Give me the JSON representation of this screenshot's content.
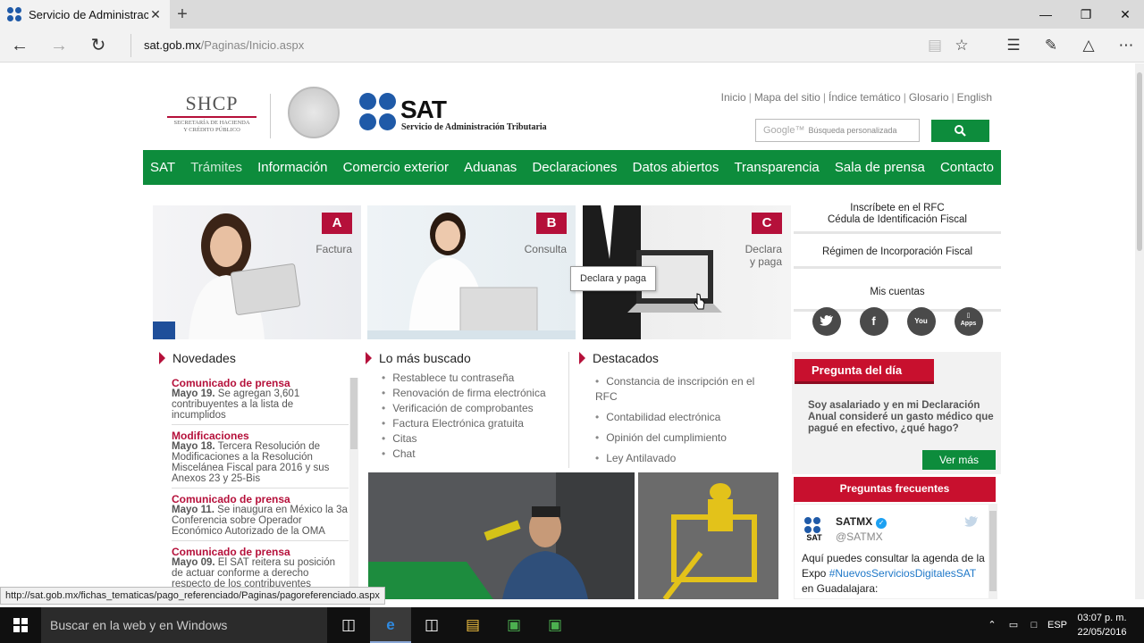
{
  "browser": {
    "tab_title": "Servicio de Administrac",
    "tab_close": "✕",
    "new_tab": "+",
    "url_host": "sat.gob.mx",
    "url_path": "/Paginas/Inicio.aspx",
    "status_url": "http://sat.gob.mx/fichas_tematicas/pago_referenciado/Paginas/pagoreferenciado.aspx"
  },
  "header": {
    "shcp_title": "SHCP",
    "shcp_sub1": "SECRETARÍA DE HACIENDA",
    "shcp_sub2": "Y CRÉDITO PÚBLICO",
    "sat_title": "SAT",
    "sat_subtitle": "Servicio de Administración Tributaria",
    "top_links": [
      "Inicio",
      "Mapa del sitio",
      "Índice temático",
      "Glosario",
      "English"
    ],
    "search_brand": "Google™",
    "search_placeholder": "Búsqueda personalizada"
  },
  "nav": {
    "items": [
      "SAT",
      "Trámites",
      "Información",
      "Comercio exterior",
      "Aduanas",
      "Declaraciones",
      "Datos abiertos",
      "Transparencia",
      "Sala de prensa",
      "Contacto"
    ]
  },
  "hero": [
    {
      "badge": "A",
      "label": "Factura"
    },
    {
      "badge": "B",
      "label": "Consulta"
    },
    {
      "badge": "C",
      "label_line1": "Declara",
      "label_line2": "y paga"
    }
  ],
  "tooltip": "Declara y paga",
  "side": {
    "rfc_line1": "Inscríbete en el RFC",
    "rfc_line2": "Cédula de Identificación Fiscal",
    "regimen": "Régimen de Incorporación Fiscal",
    "mis_cuentas": "Mis cuentas",
    "apps_label": "Apps"
  },
  "novedades": {
    "title": "Novedades",
    "items": [
      {
        "kind": "Comunicado de prensa",
        "date": "Mayo 19.",
        "body": "Se agregan 3,601 contribuyentes a la lista de incumplidos"
      },
      {
        "kind": "Modificaciones",
        "date": "Mayo 18.",
        "body": "Tercera Resolución de Modificaciones a la Resolución Miscelánea Fiscal para 2016 y sus Anexos 23 y 25-Bis"
      },
      {
        "kind": "Comunicado de prensa",
        "date": "Mayo 11.",
        "body": "Se inaugura en México la 3a Conferencia sobre Operador Económico Autorizado de la OMA"
      },
      {
        "kind": "Comunicado de prensa",
        "date": "Mayo 09.",
        "body": "El SAT reitera su posición de actuar conforme a derecho respecto de los contribuyentes señalados de contratar empresas offshore"
      }
    ]
  },
  "mas_buscado": {
    "title": "Lo más buscado",
    "items": [
      "Restablece tu contraseña",
      "Renovación de firma electrónica",
      "Verificación de comprobantes",
      "Factura Electrónica gratuita",
      "Citas",
      "Chat"
    ]
  },
  "destacados": {
    "title": "Destacados",
    "items": [
      "Constancia de inscripción en el RFC",
      "Contabilidad electrónica",
      "Opinión del cumplimiento",
      "Ley Antilavado"
    ]
  },
  "pregunta": {
    "tag": "Pregunta del día",
    "question": "Soy asalariado y en mi Declaración Anual consideré un gasto médico que pagué en efectivo, ¿qué hago?",
    "ver_mas": "Ver más",
    "faq": "Preguntas frecuentes"
  },
  "tweet": {
    "logo_text": "SAT",
    "name": "SATMX",
    "handle": "@SATMX",
    "text_before": "Aquí puedes consultar la agenda de la Expo ",
    "hashtag": "#NuevosServiciosDigitalesSAT",
    "text_after": " en Guadalajara:"
  },
  "taskbar": {
    "search_placeholder": "Buscar en la web y en Windows",
    "lang": "ESP",
    "time": "03:07 p. m.",
    "date": "22/05/2016"
  }
}
